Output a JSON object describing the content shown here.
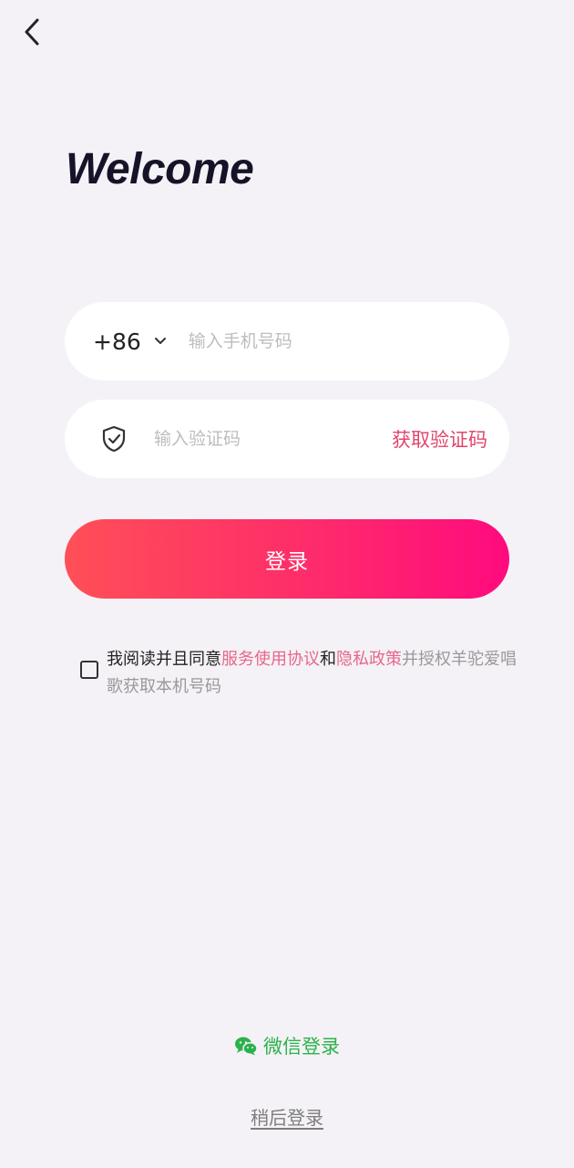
{
  "nav": {
    "back_icon": "chevron-left-icon"
  },
  "header": {
    "title": "Welcome"
  },
  "phone_field": {
    "country_code": "+86",
    "dropdown_icon": "chevron-down-icon",
    "placeholder": "输入手机号码",
    "value": ""
  },
  "code_field": {
    "icon": "shield-check-icon",
    "placeholder": "输入验证码",
    "value": "",
    "get_code_label": "获取验证码"
  },
  "login_button": {
    "label": "登录"
  },
  "agreement": {
    "checked": false,
    "prefix": "我阅读并且同意",
    "terms_link": "服务使用协议",
    "conjunction": "和",
    "privacy_link": "隐私政策",
    "suffix": "并授权羊驼爱唱歌获取本机号码"
  },
  "wechat_login": {
    "icon": "wechat-icon",
    "label": "微信登录"
  },
  "later_login": {
    "label": "稍后登录"
  },
  "colors": {
    "background": "#f4f2f6",
    "accent": "#e0466a",
    "gradient_start": "#ff4f57",
    "gradient_end": "#ff0a7e",
    "wechat_green": "#2bb24c"
  }
}
